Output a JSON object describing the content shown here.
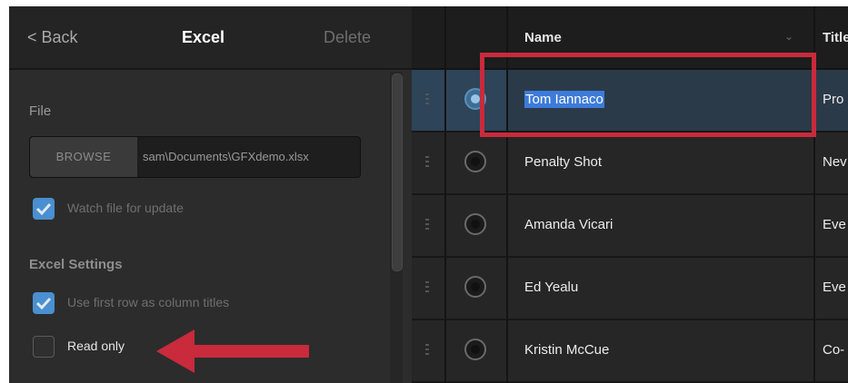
{
  "left_panel": {
    "back_label": "< Back",
    "title": "Excel",
    "delete_label": "Delete",
    "file_section_label": "File",
    "browse_label": "BROWSE",
    "file_path": "sam\\Documents\\GFXdemo.xlsx",
    "watch_label": "Watch file for update",
    "watch_checked": true,
    "excel_settings_label": "Excel Settings",
    "first_row_label": "Use first row as column titles",
    "first_row_checked": true,
    "read_only_label": "Read only",
    "read_only_checked": false
  },
  "table": {
    "columns": [
      "Name",
      "Title"
    ],
    "rows": [
      {
        "name": "Tom Iannaco",
        "title": "Pro",
        "selected": true
      },
      {
        "name": "Penalty Shot",
        "title": "Nev",
        "selected": false
      },
      {
        "name": "Amanda Vicari",
        "title": "Eve",
        "selected": false
      },
      {
        "name": "Ed Yealu",
        "title": "Eve",
        "selected": false
      },
      {
        "name": "Kristin McCue",
        "title": "Co-",
        "selected": false
      }
    ]
  },
  "colors": {
    "accent": "#4a8fd0",
    "annotation_red": "#c92a3c",
    "selection": "#3d7bd9"
  }
}
